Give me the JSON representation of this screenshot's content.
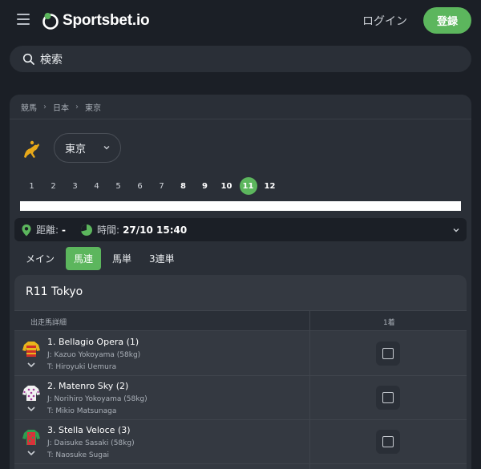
{
  "header": {
    "brand": "Sportsbet.io",
    "login_label": "ログイン",
    "register_label": "登録",
    "accent_color": "#5cb65d"
  },
  "search": {
    "placeholder": "検索"
  },
  "breadcrumb": [
    "競馬",
    "日本",
    "東京"
  ],
  "track": {
    "icon": "horse-racing-icon",
    "selected": "東京"
  },
  "races": {
    "numbers": [
      "1",
      "2",
      "3",
      "4",
      "5",
      "6",
      "7",
      "8",
      "9",
      "10",
      "11",
      "12"
    ],
    "active": "11"
  },
  "info": {
    "distance_label": "距離:",
    "distance_value": "-",
    "time_label": "時間:",
    "time_value": "27/10 15:40"
  },
  "tabs": [
    {
      "label": "メイン",
      "active": false
    },
    {
      "label": "馬連",
      "active": true
    },
    {
      "label": "馬単",
      "active": false
    },
    {
      "label": "3連単",
      "active": false
    }
  ],
  "race": {
    "title": "R11 Tokyo",
    "col_runner": "出走馬詳細",
    "col_position": "1着",
    "runners": [
      {
        "name": "1. Bellagio Opera (1)",
        "jockey": "J: Kazuo Yokoyama (58kg)",
        "trainer": "T: Hiroyuki Uemura",
        "silk_colors": [
          "#e8b51c",
          "#d0302a"
        ]
      },
      {
        "name": "2. Matenro Sky (2)",
        "jockey": "J: Norihiro Yokoyama (58kg)",
        "trainer": "T: Mikio Matsunaga",
        "silk_colors": [
          "#f2f2f2",
          "#a03a9a"
        ]
      },
      {
        "name": "3. Stella Veloce (3)",
        "jockey": "J: Daisuke Sasaki (58kg)",
        "trainer": "T: Naosuke Sugai",
        "silk_colors": [
          "#2e9e4f",
          "#d8323a"
        ]
      }
    ]
  }
}
